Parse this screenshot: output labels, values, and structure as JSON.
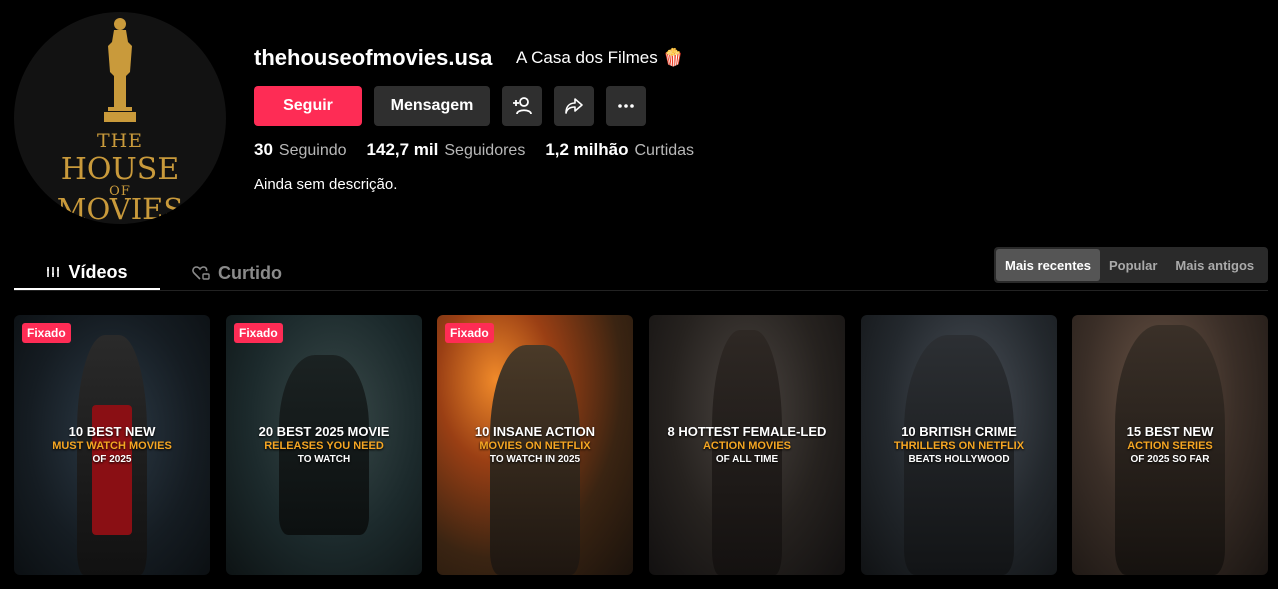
{
  "profile": {
    "username": "thehouseofmovies.usa",
    "nickname": "A Casa dos Filmes 🍿",
    "bio": "Ainda sem descrição.",
    "logo": {
      "line1": "THE",
      "line2": "HOUSE",
      "line3": "OF",
      "line4": "MOVIES"
    }
  },
  "actions": {
    "follow": "Seguir",
    "message": "Mensagem",
    "add_user_icon": "person-plus-icon",
    "share_icon": "share-arrow-icon",
    "more_icon": "ellipsis-icon"
  },
  "stats": {
    "following": {
      "count": "30",
      "label": "Seguindo"
    },
    "followers": {
      "count": "142,7 mil",
      "label": "Seguidores"
    },
    "likes": {
      "count": "1,2 milhão",
      "label": "Curtidas"
    }
  },
  "tabs": [
    {
      "label": "Vídeos",
      "icon": "grid-lines-icon",
      "active": true
    },
    {
      "label": "Curtido",
      "icon": "heart-lock-icon",
      "active": false
    }
  ],
  "sort": [
    {
      "label": "Mais recentes",
      "active": true
    },
    {
      "label": "Popular",
      "active": false
    },
    {
      "label": "Mais antigos",
      "active": false
    }
  ],
  "videos": [
    {
      "pinned": "Fixado",
      "l1": "10 BEST NEW",
      "l2": "MUST WATCH MOVIES",
      "l3": "OF 2025",
      "bg": "#1c2630",
      "accent": "#7a1010"
    },
    {
      "pinned": "Fixado",
      "l1": "20 BEST 2025 MOVIE",
      "l2": "RELEASES YOU NEED",
      "l3": "TO WATCH",
      "bg": "#1d2a2c",
      "accent": "#2b3b3b"
    },
    {
      "pinned": "Fixado",
      "l1": "10 INSANE ACTION",
      "l2": "MOVIES ON NETFLIX",
      "l3": "TO WATCH IN 2025",
      "bg": "#3a2412",
      "accent": "#d9661f"
    },
    {
      "pinned": "",
      "l1": "8 HOTTEST FEMALE-LED",
      "l2": "ACTION MOVIES",
      "l3": "OF ALL TIME",
      "bg": "#22201e",
      "accent": "#4a3d33"
    },
    {
      "pinned": "",
      "l1": "10 BRITISH CRIME",
      "l2": "THRILLERS ON NETFLIX",
      "l3": "BEATS HOLLYWOOD",
      "bg": "#1e2226",
      "accent": "#3a3e44"
    },
    {
      "pinned": "",
      "l1": "15 BEST NEW",
      "l2": "ACTION SERIES",
      "l3": "OF 2025 SO FAR",
      "bg": "#2a2420",
      "accent": "#5a4434"
    }
  ],
  "colors": {
    "brand": "#fe2c55",
    "gold": "#c99a3b",
    "accent_orange": "#f5a623"
  }
}
